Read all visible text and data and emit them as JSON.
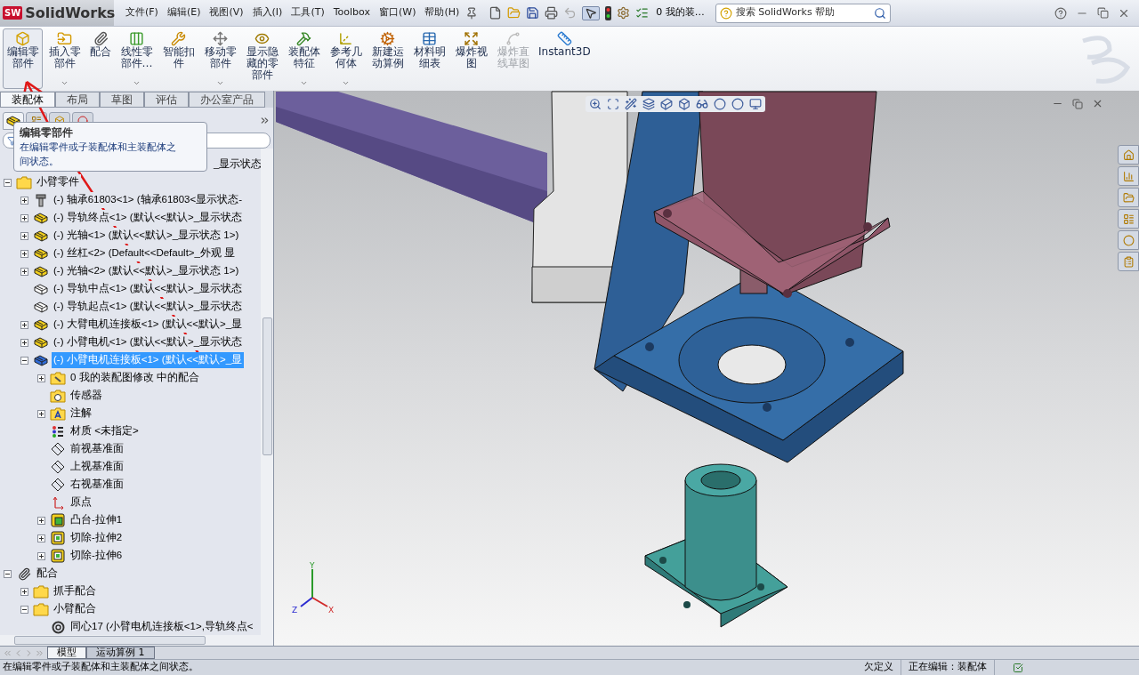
{
  "app": {
    "logo_mark": "SW",
    "logo": "SolidWorks"
  },
  "menu": [
    "文件(F)",
    "编辑(E)",
    "视图(V)",
    "插入(I)",
    "工具(T)",
    "Toolbox",
    "窗口(W)",
    "帮助(H)"
  ],
  "document_title": "0 我的装…",
  "search": {
    "placeholder": "搜索 SolidWorks 帮助"
  },
  "ribbon": [
    {
      "label": "编辑零部件",
      "selected": true,
      "disabled": false,
      "menu": false
    },
    {
      "label": "插入零部件",
      "selected": false,
      "disabled": false,
      "menu": true
    },
    {
      "label": "配合",
      "selected": false,
      "disabled": false,
      "menu": false
    },
    {
      "label": "线性零部件…",
      "selected": false,
      "disabled": false,
      "menu": true
    },
    {
      "label": "智能扣件",
      "selected": false,
      "disabled": false,
      "menu": false
    },
    {
      "label": "移动零部件",
      "selected": false,
      "disabled": false,
      "menu": true
    },
    {
      "label": "显示隐藏的零部件",
      "selected": false,
      "disabled": false,
      "menu": false
    },
    {
      "label": "装配体特征",
      "selected": false,
      "disabled": false,
      "menu": true
    },
    {
      "label": "参考几何体",
      "selected": false,
      "disabled": false,
      "menu": true
    },
    {
      "label": "新建运动算例",
      "selected": false,
      "disabled": false,
      "menu": false
    },
    {
      "label": "材料明细表",
      "selected": false,
      "disabled": false,
      "menu": false
    },
    {
      "label": "爆炸视图",
      "selected": false,
      "disabled": false,
      "menu": false
    },
    {
      "label": "爆炸直线草图",
      "selected": false,
      "disabled": true,
      "menu": false
    },
    {
      "label": "Instant3D",
      "selected": false,
      "disabled": false,
      "menu": false
    }
  ],
  "ribbon_tabs": [
    {
      "label": "装配体",
      "selected": true
    },
    {
      "label": "布局",
      "selected": false
    },
    {
      "label": "草图",
      "selected": false
    },
    {
      "label": "评估",
      "selected": false
    },
    {
      "label": "办公室产品",
      "selected": false
    }
  ],
  "tooltip": {
    "title": "编辑零部件",
    "text": "在编辑零件或子装配体和主装配体之间状态。"
  },
  "tree": [
    {
      "kind": "covered",
      "label": "_显示状态",
      "selected": false
    },
    {
      "kind": "folder",
      "label": "小臂零件",
      "selected": false,
      "expanded": true,
      "children": [
        {
          "kind": "fastener",
          "label": "(-) 轴承61803<1> (轴承61803<显示状态-",
          "selected": false,
          "expanded": false
        },
        {
          "kind": "part",
          "label": "(-) 导轨终点<1> (默认<<默认>_显示状态",
          "selected": false,
          "expanded": false
        },
        {
          "kind": "part",
          "label": "(-) 光轴<1> (默认<<默认>_显示状态 1>)",
          "selected": false,
          "expanded": false
        },
        {
          "kind": "part",
          "label": "(-) 丝杠<2> (Default<<Default>_外观 显",
          "selected": false,
          "expanded": false
        },
        {
          "kind": "part",
          "label": "(-) 光轴<2> (默认<<默认>_显示状态 1>)",
          "selected": false,
          "expanded": false
        },
        {
          "kind": "part-hidden",
          "label": "(-) 导轨中点<1> (默认<<默认>_显示状态",
          "selected": false
        },
        {
          "kind": "part-hidden",
          "label": "(-) 导轨起点<1> (默认<<默认>_显示状态",
          "selected": false
        },
        {
          "kind": "part",
          "label": "(-) 大臂电机连接板<1> (默认<<默认>_显",
          "selected": false,
          "expanded": false
        },
        {
          "kind": "part",
          "label": "(-) 小臂电机<1> (默认<<默认>_显示状态",
          "selected": false,
          "expanded": false
        },
        {
          "kind": "part-edit",
          "label": "(-) 小臂电机连接板<1> (默认<<默认>_显",
          "selected": true,
          "expanded": true,
          "children": [
            {
              "kind": "mates-folder",
              "label": "0 我的装配图修改 中的配合",
              "selected": false,
              "expanded": false
            },
            {
              "kind": "sensor-folder",
              "label": "传感器",
              "selected": false
            },
            {
              "kind": "annotation-folder",
              "label": "注解",
              "selected": false,
              "expanded": false
            },
            {
              "kind": "material",
              "label": "材质 <未指定>",
              "selected": false
            },
            {
              "kind": "plane",
              "label": "前视基准面",
              "selected": false
            },
            {
              "kind": "plane",
              "label": "上视基准面",
              "selected": false
            },
            {
              "kind": "plane",
              "label": "右视基准面",
              "selected": false
            },
            {
              "kind": "origin",
              "label": "原点",
              "selected": false
            },
            {
              "kind": "boss",
              "label": "凸台-拉伸1",
              "selected": false,
              "expanded": false
            },
            {
              "kind": "cut",
              "label": "切除-拉伸2",
              "selected": false,
              "expanded": false
            },
            {
              "kind": "cut",
              "label": "切除-拉伸6",
              "selected": false,
              "expanded": false
            }
          ]
        }
      ]
    },
    {
      "kind": "mates",
      "label": "配合",
      "selected": false,
      "expanded": true,
      "children": [
        {
          "kind": "folder",
          "label": "抓手配合",
          "selected": false,
          "expanded": false
        },
        {
          "kind": "folder",
          "label": "小臂配合",
          "selected": false,
          "expanded": true,
          "children": [
            {
              "kind": "concentric",
              "label": "同心17 (小臂电机连接板<1>,导轨终点<",
              "selected": false
            }
          ]
        }
      ]
    }
  ],
  "bottom_tabs": [
    {
      "label": "模型",
      "selected": true
    },
    {
      "label": "运动算例 1",
      "selected": false
    }
  ],
  "triad": [
    "Y",
    "Z",
    "X"
  ],
  "status_bar": {
    "message": "在编辑零件或子装配体和主装配体之间状态。",
    "state": "欠定义",
    "editing": "正在编辑：装配体"
  }
}
